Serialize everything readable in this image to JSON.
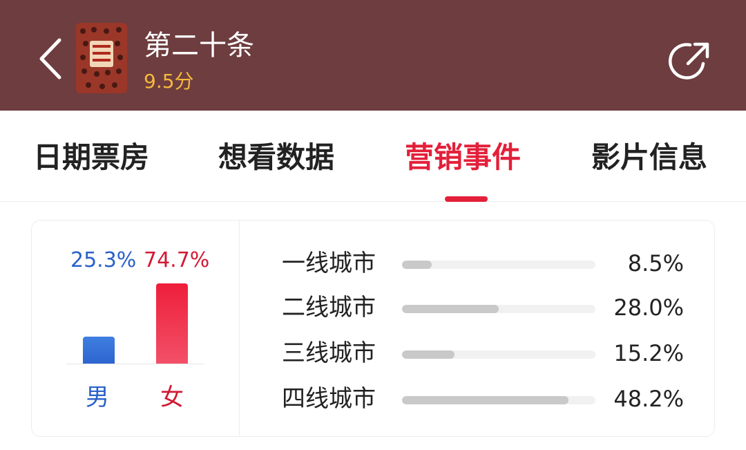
{
  "header": {
    "title": "第二十条",
    "score": "9.5分",
    "back_icon": "chevron-left-icon",
    "share_icon": "share-arrow-icon",
    "bg_color": "#6e3d3f",
    "score_color": "#f5b93d"
  },
  "tabs": [
    {
      "label": "日期票房",
      "active": false
    },
    {
      "label": "想看数据",
      "active": false
    },
    {
      "label": "营销事件",
      "active": true
    },
    {
      "label": "影片信息",
      "active": false
    }
  ],
  "accent_color": "#e3203a",
  "gender": {
    "male": {
      "label": "男",
      "percent_text": "25.3%",
      "value": 25.3,
      "color": "#2a61c8"
    },
    "female": {
      "label": "女",
      "percent_text": "74.7%",
      "value": 74.7,
      "color": "#d11a35"
    }
  },
  "cities": [
    {
      "label": "一线城市",
      "value_text": "8.5%",
      "value": 8.5
    },
    {
      "label": "二线城市",
      "value_text": "28.0%",
      "value": 28.0
    },
    {
      "label": "三线城市",
      "value_text": "15.2%",
      "value": 15.2
    },
    {
      "label": "四线城市",
      "value_text": "48.2%",
      "value": 48.2
    }
  ]
}
